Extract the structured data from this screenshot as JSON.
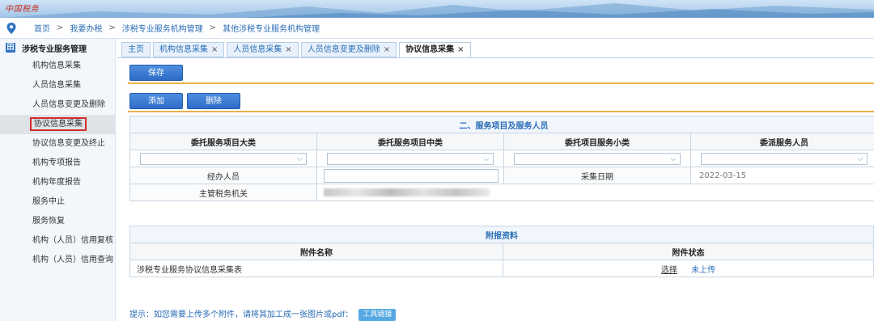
{
  "banner": {
    "logo": "中国税务"
  },
  "breadcrumb": [
    "首页",
    "我要办税",
    "涉税专业服务机构管理",
    "其他涉税专业服务机构管理"
  ],
  "breadcrumb_sep": ">",
  "sidebar": {
    "title": "涉税专业服务管理",
    "title_icon": "田",
    "items": [
      "机构信息采集",
      "人员信息采集",
      "人员信息变更及删除",
      "协议信息采集",
      "协议信息变更及终止",
      "机构专项报告",
      "机构年度报告",
      "服务中止",
      "服务恢复",
      "机构（人员）信用复核",
      "机构（人员）信用查询"
    ],
    "active_index": 3
  },
  "tabs": [
    {
      "label": "主页",
      "closable": false
    },
    {
      "label": "机构信息采集",
      "closable": true
    },
    {
      "label": "人员信息采集",
      "closable": true
    },
    {
      "label": "人员信息变更及删除",
      "closable": true
    },
    {
      "label": "协议信息采集",
      "closable": true,
      "active": true
    }
  ],
  "tab_close": "×",
  "toolbar": {
    "save": "保存",
    "add": "添加",
    "delete": "删除"
  },
  "service_section": {
    "title": "二、服务项目及服务人员",
    "columns": [
      "委托服务项目大类",
      "委托服务项目中类",
      "委托项目服务小类",
      "委派服务人员"
    ],
    "handler_label": "经办人员",
    "handler_value": "",
    "date_label": "采集日期",
    "date_value": "2022-03-15",
    "tax_office_label": "主管税务机关"
  },
  "attachments": {
    "title": "附报资料",
    "col_name": "附件名称",
    "col_status": "附件状态",
    "rows": [
      {
        "name": "涉税专业服务协议信息采集表",
        "action": "选择",
        "status": "未上传"
      }
    ]
  },
  "hint": {
    "text": "提示：如您需要上传多个附件，请将其加工成一张图片或pdf：",
    "tool_button": "工具链接"
  },
  "colors": {
    "accent": "#2a6db6",
    "button": "#2e6cc8",
    "rule": "#e8b248",
    "highlight": "#d42a2a"
  }
}
